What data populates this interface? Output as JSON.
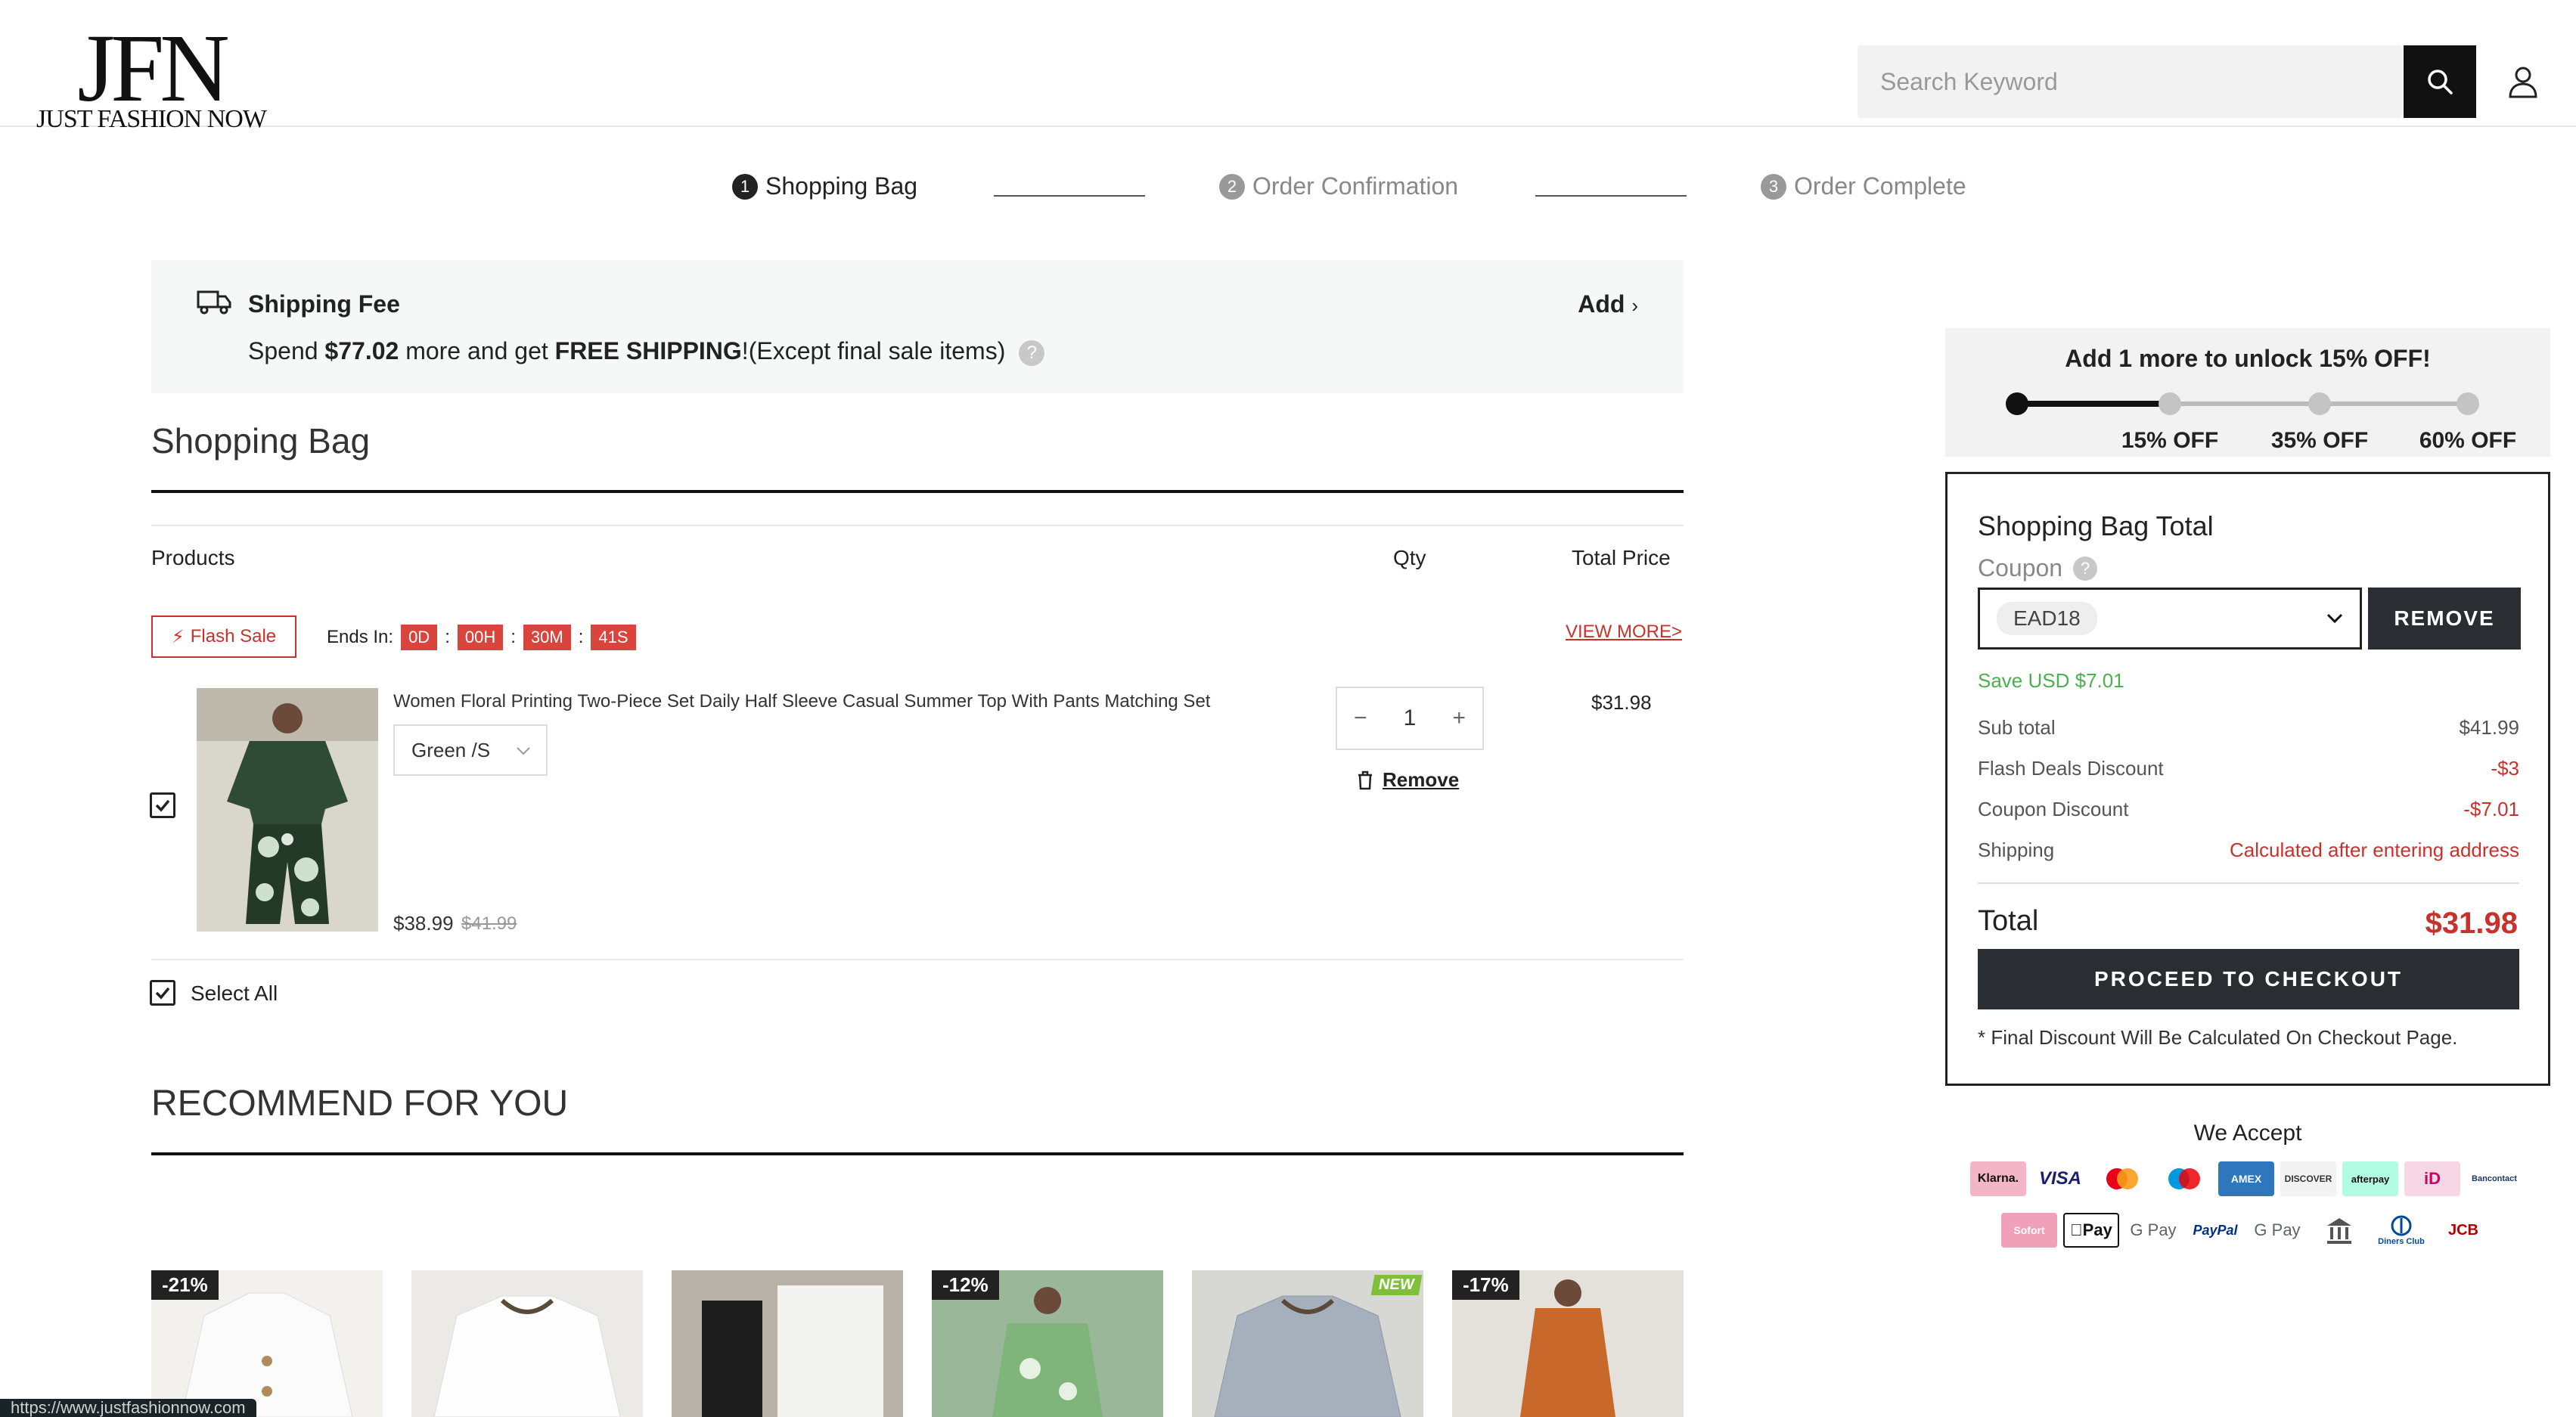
{
  "brand": {
    "logo_mark": "JFN",
    "logo_text": "JUST FASHION NOW"
  },
  "header": {
    "search_placeholder": "Search Keyword"
  },
  "steps": [
    {
      "num": "1",
      "label": "Shopping Bag"
    },
    {
      "num": "2",
      "label": "Order Confirmation"
    },
    {
      "num": "3",
      "label": "Order Complete"
    }
  ],
  "shipping": {
    "title": "Shipping Fee",
    "text_prefix": "Spend ",
    "amount": "$77.02",
    "text_mid": " more and get ",
    "free": "FREE SHIPPING",
    "text_suffix": "!(Except final sale items)",
    "help": "?",
    "add_label": "Add"
  },
  "bag": {
    "title": "Shopping Bag",
    "col_products": "Products",
    "col_qty": "Qty",
    "col_total": "Total Price",
    "flash_label": "Flash Sale",
    "ends_label": "Ends In:",
    "timer": [
      "0D",
      "00H",
      "30M",
      "41S"
    ],
    "timer_sep": ":",
    "view_more": "VIEW MORE>",
    "select_all": "Select All",
    "item": {
      "name": "Women Floral Printing Two-Piece Set Daily Half Sleeve Casual Summer Top With Pants Matching Set",
      "variant": "Green /S",
      "price_now": "$38.99",
      "price_old": "$41.99",
      "qty": "1",
      "qty_minus": "−",
      "qty_plus": "+",
      "remove": "Remove",
      "line_total": "$31.98"
    }
  },
  "recommend": {
    "title": "RECOMMEND FOR YOU",
    "cards": [
      {
        "badge": "-21%"
      },
      {
        "badge": ""
      },
      {
        "badge": ""
      },
      {
        "badge": "-12%"
      },
      {
        "badge": "",
        "new": "NEW"
      },
      {
        "badge": "-17%"
      }
    ]
  },
  "status_url": "https://www.justfashionnow.com",
  "unlock": {
    "title": "Add 1 more to unlock 15% OFF!",
    "tiers": [
      "15% OFF",
      "35% OFF",
      "60% OFF"
    ],
    "progress": 0.33
  },
  "summary": {
    "title": "Shopping Bag Total",
    "coupon_label": "Coupon",
    "coupon_help": "?",
    "coupon_code": "EAD18",
    "remove_label": "REMOVE",
    "save_text": "Save USD $7.01",
    "rows": [
      {
        "label": "Sub total",
        "value": "$41.99"
      },
      {
        "label": "Flash Deals Discount",
        "value": "-$3"
      },
      {
        "label": "Coupon Discount",
        "value": "-$7.01"
      },
      {
        "label": "Shipping",
        "value": "Calculated after entering address"
      }
    ],
    "total_label": "Total",
    "total_value": "$31.98",
    "checkout_label": "PROCEED TO CHECKOUT",
    "note": "* Final Discount Will Be Calculated On Checkout Page."
  },
  "payment": {
    "title": "We Accept",
    "row1": [
      "Klarna.",
      "VISA",
      "",
      "",
      "AMEX",
      "DISCOVER",
      "afterpay",
      "iD",
      "Bancontact"
    ],
    "row2": [
      "Sofort",
      "Pay",
      "G Pay",
      "PayPal",
      "G Pay",
      "Bank",
      "Diners Club",
      "JCB"
    ]
  },
  "colors": {
    "accent_red": "#c8322c",
    "dark_button": "#2a2e33",
    "save_green": "#4caf50"
  }
}
